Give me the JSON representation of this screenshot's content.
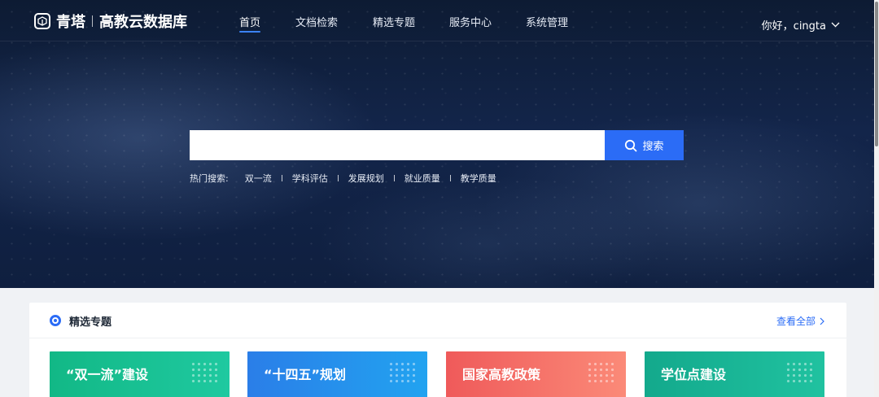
{
  "header": {
    "brand": "青塔",
    "subtitle": "高教云数据库",
    "nav": [
      {
        "label": "首页",
        "active": true
      },
      {
        "label": "文档检索"
      },
      {
        "label": "精选专题"
      },
      {
        "label": "服务中心"
      },
      {
        "label": "系统管理"
      }
    ],
    "user_greeting": "你好，cingta"
  },
  "search": {
    "placeholder": "",
    "button_label": "搜索",
    "hot_label": "热门搜索:",
    "hot_terms": [
      "双一流",
      "学科评估",
      "发展规划",
      "就业质量",
      "教学质量"
    ]
  },
  "featured": {
    "title": "精选专题",
    "view_all": "查看全部",
    "cards": [
      {
        "title": "“双一流”建设"
      },
      {
        "title": "“十四五”规划"
      },
      {
        "title": "国家高教政策"
      },
      {
        "title": "学位点建设"
      }
    ]
  },
  "colors": {
    "accent": "#2b6cf6",
    "hero_bg": "#13254a",
    "card_1": "#12b886",
    "card_2": "#2a7ee8",
    "card_3": "#ef5a5a",
    "card_4": "#13a98c"
  },
  "icons": {
    "logo": "cube-logo-icon",
    "search": "search-icon",
    "user_menu": "chevron-down-icon",
    "view_all": "chevron-right-icon",
    "section": "target-circle-icon"
  }
}
